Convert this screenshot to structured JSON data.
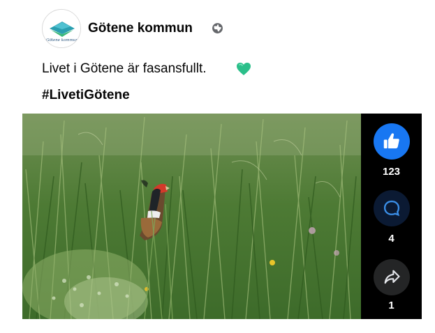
{
  "post": {
    "author": "Götene kommun",
    "logo_text": "Götene kommun",
    "caption": "Livet i Götene är fasansfullt.",
    "hashtag": "#LivetiGötene",
    "privacy_icon": "globe-icon",
    "emoji_icon": "green-heart-icon"
  },
  "reactions": {
    "likes": "123",
    "comments": "4",
    "shares": "1",
    "like_icon": "thumbs-up-icon",
    "comment_icon": "comment-bubble-icon",
    "share_icon": "share-arrow-icon"
  },
  "colors": {
    "like_accent": "#1877f2",
    "comment_bg": "#0b1a33",
    "share_bg": "#242526",
    "rail_bg": "#000000",
    "heart": "#2bbf8a"
  }
}
